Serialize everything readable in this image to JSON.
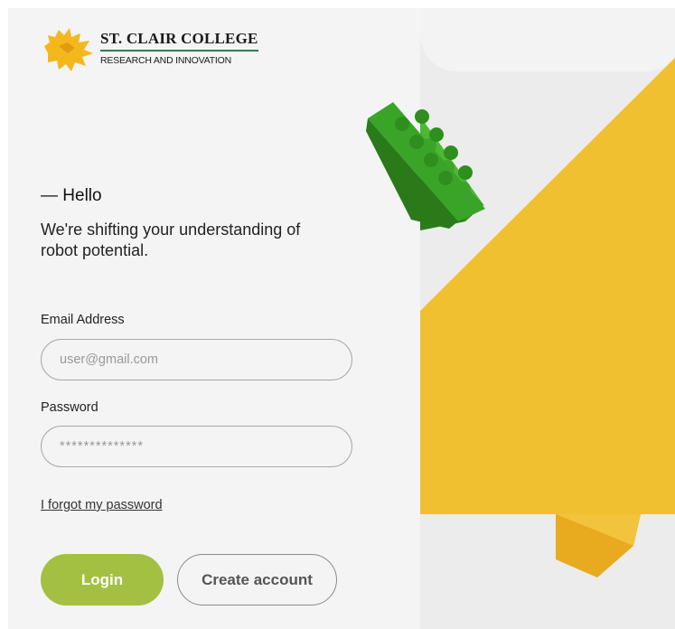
{
  "logo": {
    "line1": "ST. CLAIR COLLEGE",
    "line2": "RESEARCH AND INNOVATION"
  },
  "intro": {
    "greeting": "— Hello",
    "tagline": "We're shifting your understanding of robot potential."
  },
  "form": {
    "email_label": "Email Address",
    "email_placeholder": "user@gmail.com",
    "password_label": "Password",
    "password_placeholder": "**************",
    "forgot_link": "I forgot my password",
    "login_button": "Login",
    "create_button": "Create account"
  },
  "colors": {
    "accent_green": "#a3c043",
    "brand_yellow": "#f0c030",
    "lego_green": "#33a020"
  }
}
